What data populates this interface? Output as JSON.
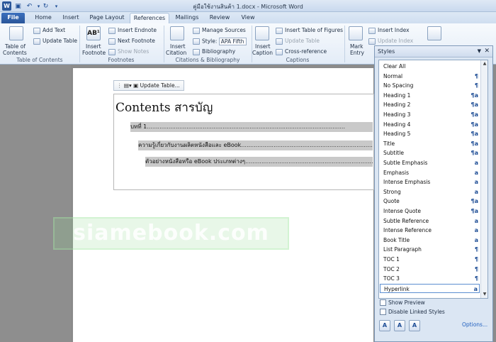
{
  "window": {
    "title": "คู่มือใช้งานสินค้า 1.docx - Microsoft Word",
    "app_icon": "W",
    "quick_access": [
      "save-icon",
      "undo-icon",
      "redo-icon",
      "customize-icon"
    ]
  },
  "tabs": [
    {
      "label": "File"
    },
    {
      "label": "Home"
    },
    {
      "label": "Insert"
    },
    {
      "label": "Page Layout"
    },
    {
      "label": "References"
    },
    {
      "label": "Mailings"
    },
    {
      "label": "Review"
    },
    {
      "label": "View"
    }
  ],
  "ribbon": {
    "toc": {
      "big_label_1": "Table of",
      "big_label_2": "Contents",
      "add_text": "Add Text",
      "update_table": "Update Table",
      "group": "Table of Contents"
    },
    "footnotes": {
      "big_label_1": "Insert",
      "big_label_2": "Footnote",
      "insert_endnote": "Insert Endnote",
      "next_footnote": "Next Footnote",
      "show_notes": "Show Notes",
      "group": "Footnotes"
    },
    "citations": {
      "big_label_1": "Insert",
      "big_label_2": "Citation",
      "manage_sources": "Manage Sources",
      "style_label": "Style:",
      "style_value": "APA Fifth",
      "bibliography": "Bibliography",
      "group": "Citations & Bibliography"
    },
    "captions": {
      "big_label_1": "Insert",
      "big_label_2": "Caption",
      "insert_tof": "Insert Table of Figures",
      "update_table": "Update Table",
      "cross_reference": "Cross-reference",
      "group": "Captions"
    },
    "index": {
      "big_label_1": "Mark",
      "big_label_2": "Entry",
      "insert_index": "Insert Index",
      "update_index": "Update Index"
    }
  },
  "document": {
    "toc_toolbar_label": "Update Table...",
    "toc_heading": "Contents สารบัญ",
    "entries": [
      {
        "text": "บทที่ 1"
      },
      {
        "text": "ความรู้เกี่ยวกับงานผลิตหนังสือและ eBook"
      },
      {
        "text": "ตัวอย่างหนังสือหรือ eBook ประเภทต่างๆ"
      }
    ],
    "watermark": "siamebook.com"
  },
  "styles_pane": {
    "title": "Styles",
    "items": [
      {
        "name": "Clear All",
        "glyph": ""
      },
      {
        "name": "Normal",
        "glyph": "¶"
      },
      {
        "name": "No Spacing",
        "glyph": "¶"
      },
      {
        "name": "Heading 1",
        "glyph": "¶a"
      },
      {
        "name": "Heading 2",
        "glyph": "¶a"
      },
      {
        "name": "Heading 3",
        "glyph": "¶a"
      },
      {
        "name": "Heading 4",
        "glyph": "¶a"
      },
      {
        "name": "Heading 5",
        "glyph": "¶a"
      },
      {
        "name": "Title",
        "glyph": "¶a"
      },
      {
        "name": "Subtitle",
        "glyph": "¶a"
      },
      {
        "name": "Subtle Emphasis",
        "glyph": "a"
      },
      {
        "name": "Emphasis",
        "glyph": "a"
      },
      {
        "name": "Intense Emphasis",
        "glyph": "a"
      },
      {
        "name": "Strong",
        "glyph": "a"
      },
      {
        "name": "Quote",
        "glyph": "¶a"
      },
      {
        "name": "Intense Quote",
        "glyph": "¶a"
      },
      {
        "name": "Subtle Reference",
        "glyph": "a"
      },
      {
        "name": "Intense Reference",
        "glyph": "a"
      },
      {
        "name": "Book Title",
        "glyph": "a"
      },
      {
        "name": "List Paragraph",
        "glyph": "¶"
      },
      {
        "name": "TOC 1",
        "glyph": "¶"
      },
      {
        "name": "TOC 2",
        "glyph": "¶"
      },
      {
        "name": "TOC 3",
        "glyph": "¶"
      },
      {
        "name": "Hyperlink",
        "glyph": "a",
        "selected": true
      }
    ],
    "show_preview": "Show Preview",
    "disable_linked": "Disable Linked Styles",
    "options_link": "Options..."
  },
  "colors": {
    "file_tab": "#2a5699",
    "accent": "#1f4e96"
  }
}
